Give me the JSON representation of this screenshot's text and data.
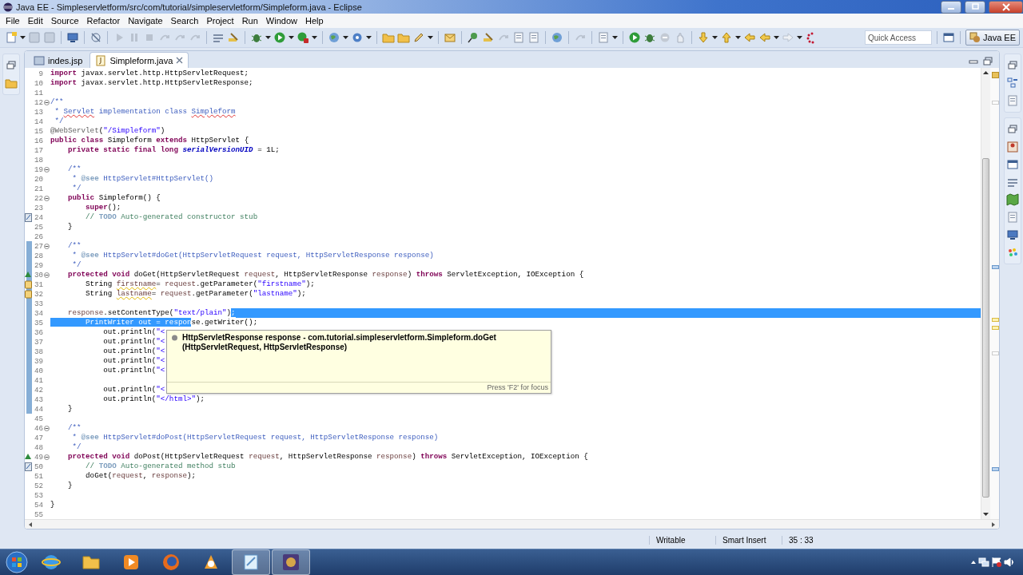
{
  "window": {
    "title": "Java EE - Simpleservletform/src/com/tutorial/simpleservletform/Simpleform.java - Eclipse"
  },
  "menu": [
    "File",
    "Edit",
    "Source",
    "Refactor",
    "Navigate",
    "Search",
    "Project",
    "Run",
    "Window",
    "Help"
  ],
  "toolbar": {
    "quick_access": {
      "placeholder": "Quick Access"
    },
    "perspective": {
      "label": "Java EE",
      "selected": true
    }
  },
  "editor": {
    "tabs": [
      {
        "label": "indes.jsp",
        "kind": "jsp",
        "selected": false,
        "closable": false
      },
      {
        "label": "Simpleform.java",
        "kind": "java",
        "selected": true,
        "closable": true
      }
    ],
    "lines": [
      {
        "number": "9",
        "kind": "code",
        "folding": false,
        "changed": false,
        "selected_to_end": false,
        "segments": [
          {
            "kind": "kw",
            "text": "import"
          },
          {
            "kind": "text",
            "text": " javax.servlet.http.HttpServletRequest;"
          }
        ]
      },
      {
        "number": "10",
        "kind": "code",
        "folding": false,
        "changed": false,
        "selected_to_end": false,
        "segments": [
          {
            "kind": "kw",
            "text": "import"
          },
          {
            "kind": "text",
            "text": " javax.servlet.http.HttpServletResponse;"
          }
        ]
      },
      {
        "number": "11",
        "kind": "code",
        "folding": false,
        "changed": false,
        "selected_to_end": false
      },
      {
        "number": "12",
        "kind": "code",
        "folding": true,
        "changed": false,
        "selected_to_end": false,
        "segments": [
          {
            "kind": "doc",
            "text": "/**"
          }
        ]
      },
      {
        "number": "13",
        "kind": "code",
        "folding": false,
        "changed": false,
        "selected_to_end": false,
        "segments": [
          {
            "kind": "doc",
            "text": " * "
          },
          {
            "kind": "misspelled",
            "text": "Servlet"
          },
          {
            "kind": "doc",
            "text": " implementation class "
          },
          {
            "kind": "misspelled",
            "text": "Simpleform"
          }
        ]
      },
      {
        "number": "14",
        "kind": "code",
        "folding": false,
        "changed": false,
        "selected_to_end": false,
        "segments": [
          {
            "kind": "doc",
            "text": " */"
          }
        ]
      },
      {
        "number": "15",
        "kind": "code",
        "folding": false,
        "changed": false,
        "selected_to_end": false,
        "segments": [
          {
            "kind": "annot",
            "text": "@WebServlet"
          },
          {
            "kind": "text",
            "text": "("
          },
          {
            "kind": "string",
            "text": "\"/Simpleform\""
          },
          {
            "kind": "text",
            "text": ")"
          }
        ]
      },
      {
        "number": "16",
        "kind": "code",
        "folding": false,
        "changed": false,
        "selected_to_end": false,
        "segments": [
          {
            "kind": "kw",
            "text": "public class"
          },
          {
            "kind": "text",
            "text": " Simpleform "
          },
          {
            "kind": "kw",
            "text": "extends"
          },
          {
            "kind": "text",
            "text": " HttpServlet {"
          }
        ]
      },
      {
        "number": "17",
        "kind": "code",
        "folding": false,
        "changed": false,
        "selected_to_end": false,
        "segments": [
          {
            "kind": "kw",
            "text": "    private static final long "
          },
          {
            "kind": "field",
            "text": "serialVersionUID"
          },
          {
            "kind": "text",
            "text": " = 1L;"
          }
        ]
      },
      {
        "number": "18",
        "kind": "code",
        "folding": false,
        "changed": false,
        "selected_to_end": false
      },
      {
        "number": "19",
        "kind": "code",
        "folding": true,
        "changed": false,
        "selected_to_end": false,
        "segments": [
          {
            "kind": "doc",
            "text": "    /**"
          }
        ]
      },
      {
        "number": "20",
        "kind": "code",
        "folding": false,
        "changed": false,
        "selected_to_end": false,
        "segments": [
          {
            "kind": "doc",
            "text": "     * "
          },
          {
            "kind": "doctag",
            "text": "@see"
          },
          {
            "kind": "doc",
            "text": " HttpServlet#HttpServlet()"
          }
        ]
      },
      {
        "number": "21",
        "kind": "code",
        "folding": false,
        "changed": false,
        "selected_to_end": false,
        "segments": [
          {
            "kind": "doc",
            "text": "     */"
          }
        ]
      },
      {
        "number": "22",
        "kind": "code",
        "folding": true,
        "changed": false,
        "selected_to_end": false,
        "segments": [
          {
            "kind": "kw",
            "text": "    public"
          },
          {
            "kind": "text",
            "text": " Simpleform() {"
          }
        ]
      },
      {
        "number": "23",
        "kind": "code",
        "folding": false,
        "changed": false,
        "selected_to_end": false,
        "segments": [
          {
            "kind": "kw",
            "text": "        super"
          },
          {
            "kind": "text",
            "text": "();"
          }
        ]
      },
      {
        "number": "24",
        "kind": "task",
        "folding": false,
        "changed": false,
        "selected_to_end": false,
        "segments": [
          {
            "kind": "comment",
            "text": "        // "
          },
          {
            "kind": "todo",
            "text": "TODO"
          },
          {
            "kind": "comment",
            "text": " Auto-generated constructor stub"
          }
        ]
      },
      {
        "number": "25",
        "kind": "code",
        "folding": false,
        "changed": false,
        "selected_to_end": false,
        "segments": [
          {
            "kind": "text",
            "text": "    }"
          }
        ]
      },
      {
        "number": "26",
        "kind": "code",
        "folding": false,
        "changed": false,
        "selected_to_end": false
      },
      {
        "number": "27",
        "kind": "code",
        "folding": true,
        "changed": true,
        "selected_to_end": false,
        "segments": [
          {
            "kind": "doc",
            "text": "    /**"
          }
        ]
      },
      {
        "number": "28",
        "kind": "code",
        "folding": false,
        "changed": true,
        "selected_to_end": false,
        "segments": [
          {
            "kind": "doc",
            "text": "     * "
          },
          {
            "kind": "doctag",
            "text": "@see"
          },
          {
            "kind": "doc",
            "text": " HttpServlet#doGet(HttpServletRequest request, HttpServletResponse response)"
          }
        ]
      },
      {
        "number": "29",
        "kind": "code",
        "folding": false,
        "changed": true,
        "selected_to_end": false,
        "segments": [
          {
            "kind": "doc",
            "text": "     */"
          }
        ]
      },
      {
        "number": "30",
        "kind": "override",
        "folding": true,
        "changed": true,
        "selected_to_end": false,
        "segments": [
          {
            "kind": "kw",
            "text": "    protected void"
          },
          {
            "kind": "text",
            "text": " doGet(HttpServletRequest "
          },
          {
            "kind": "param",
            "text": "request"
          },
          {
            "kind": "text",
            "text": ", HttpServletResponse "
          },
          {
            "kind": "param",
            "text": "response"
          },
          {
            "kind": "text",
            "text": ") "
          },
          {
            "kind": "kw",
            "text": "throws"
          },
          {
            "kind": "text",
            "text": " ServletException, IOException {"
          }
        ]
      },
      {
        "number": "31",
        "kind": "warning",
        "folding": false,
        "changed": true,
        "selected_to_end": false,
        "segments": [
          {
            "kind": "text",
            "text": "        String "
          },
          {
            "kind": "warned",
            "text": "firstname"
          },
          {
            "kind": "text",
            "text": "= "
          },
          {
            "kind": "param",
            "text": "request"
          },
          {
            "kind": "text",
            "text": ".getParameter("
          },
          {
            "kind": "string",
            "text": "\"firstname\""
          },
          {
            "kind": "text",
            "text": ");"
          }
        ]
      },
      {
        "number": "32",
        "kind": "warning",
        "folding": false,
        "changed": true,
        "selected_to_end": false,
        "segments": [
          {
            "kind": "text",
            "text": "        String "
          },
          {
            "kind": "warned",
            "text": "lastname"
          },
          {
            "kind": "text",
            "text": "= "
          },
          {
            "kind": "param",
            "text": "request"
          },
          {
            "kind": "text",
            "text": ".getParameter("
          },
          {
            "kind": "string",
            "text": "\"lastname\""
          },
          {
            "kind": "text",
            "text": ");"
          }
        ]
      },
      {
        "number": "33",
        "kind": "code",
        "folding": false,
        "changed": true,
        "selected_to_end": false
      },
      {
        "number": "34",
        "kind": "code",
        "folding": false,
        "changed": true,
        "selected_to_end": true,
        "segments": [
          {
            "kind": "param",
            "text": "    response"
          },
          {
            "kind": "text",
            "text": ".setContentType("
          },
          {
            "kind": "string",
            "text": "\"text/plain\""
          },
          {
            "kind": "text",
            "text": ")"
          },
          {
            "kind": "selected",
            "text": ";"
          }
        ]
      },
      {
        "number": "35",
        "kind": "code",
        "folding": false,
        "changed": true,
        "selected_to_end": false,
        "segments": [
          {
            "kind": "selected",
            "text": "        PrintWriter out = respon"
          },
          {
            "kind": "text",
            "text": "se.getWriter();"
          }
        ]
      },
      {
        "number": "36",
        "kind": "code",
        "folding": false,
        "changed": true,
        "selected_to_end": false,
        "segments": [
          {
            "kind": "text",
            "text": "            out.println("
          },
          {
            "kind": "string",
            "text": "\"<"
          }
        ]
      },
      {
        "number": "37",
        "kind": "code",
        "folding": false,
        "changed": true,
        "selected_to_end": false,
        "segments": [
          {
            "kind": "text",
            "text": "            out.println("
          },
          {
            "kind": "string",
            "text": "\"<"
          }
        ]
      },
      {
        "number": "38",
        "kind": "code",
        "folding": false,
        "changed": true,
        "selected_to_end": false,
        "segments": [
          {
            "kind": "text",
            "text": "            out.println("
          },
          {
            "kind": "string",
            "text": "\"<"
          }
        ]
      },
      {
        "number": "39",
        "kind": "code",
        "folding": false,
        "changed": true,
        "selected_to_end": false,
        "segments": [
          {
            "kind": "text",
            "text": "            out.println("
          },
          {
            "kind": "string",
            "text": "\"<"
          }
        ]
      },
      {
        "number": "40",
        "kind": "code",
        "folding": false,
        "changed": true,
        "selected_to_end": false,
        "segments": [
          {
            "kind": "text",
            "text": "            out.println("
          },
          {
            "kind": "string",
            "text": "\"<"
          }
        ]
      },
      {
        "number": "41",
        "kind": "code",
        "folding": false,
        "changed": true,
        "selected_to_end": false
      },
      {
        "number": "42",
        "kind": "code",
        "folding": false,
        "changed": true,
        "selected_to_end": false,
        "segments": [
          {
            "kind": "text",
            "text": "            out.println("
          },
          {
            "kind": "string",
            "text": "\"<"
          }
        ]
      },
      {
        "number": "43",
        "kind": "code",
        "folding": false,
        "changed": true,
        "selected_to_end": false,
        "segments": [
          {
            "kind": "text",
            "text": "            out.println("
          },
          {
            "kind": "string",
            "text": "\"</html>\""
          },
          {
            "kind": "text",
            "text": ");"
          }
        ]
      },
      {
        "number": "44",
        "kind": "code",
        "folding": false,
        "changed": true,
        "selected_to_end": false,
        "segments": [
          {
            "kind": "text",
            "text": "    }"
          }
        ]
      },
      {
        "number": "45",
        "kind": "code",
        "folding": false,
        "changed": false,
        "selected_to_end": false
      },
      {
        "number": "46",
        "kind": "code",
        "folding": true,
        "changed": false,
        "selected_to_end": false,
        "segments": [
          {
            "kind": "doc",
            "text": "    /**"
          }
        ]
      },
      {
        "number": "47",
        "kind": "code",
        "folding": false,
        "changed": false,
        "selected_to_end": false,
        "segments": [
          {
            "kind": "doc",
            "text": "     * "
          },
          {
            "kind": "doctag",
            "text": "@see"
          },
          {
            "kind": "doc",
            "text": " HttpServlet#doPost(HttpServletRequest request, HttpServletResponse response)"
          }
        ]
      },
      {
        "number": "48",
        "kind": "code",
        "folding": false,
        "changed": false,
        "selected_to_end": false,
        "segments": [
          {
            "kind": "doc",
            "text": "     */"
          }
        ]
      },
      {
        "number": "49",
        "kind": "override",
        "folding": true,
        "changed": false,
        "selected_to_end": false,
        "segments": [
          {
            "kind": "kw",
            "text": "    protected void"
          },
          {
            "kind": "text",
            "text": " doPost(HttpServletRequest "
          },
          {
            "kind": "param",
            "text": "request"
          },
          {
            "kind": "text",
            "text": ", HttpServletResponse "
          },
          {
            "kind": "param",
            "text": "response"
          },
          {
            "kind": "text",
            "text": ") "
          },
          {
            "kind": "kw",
            "text": "throws"
          },
          {
            "kind": "text",
            "text": " ServletException, IOException {"
          }
        ]
      },
      {
        "number": "50",
        "kind": "task",
        "folding": false,
        "changed": false,
        "selected_to_end": false,
        "segments": [
          {
            "kind": "comment",
            "text": "        // "
          },
          {
            "kind": "todo",
            "text": "TODO"
          },
          {
            "kind": "comment",
            "text": " Auto-generated method stub"
          }
        ]
      },
      {
        "number": "51",
        "kind": "code",
        "folding": false,
        "changed": false,
        "selected_to_end": false,
        "segments": [
          {
            "kind": "text",
            "text": "        doGet("
          },
          {
            "kind": "param",
            "text": "request"
          },
          {
            "kind": "text",
            "text": ", "
          },
          {
            "kind": "param",
            "text": "response"
          },
          {
            "kind": "text",
            "text": ");"
          }
        ]
      },
      {
        "number": "52",
        "kind": "code",
        "folding": false,
        "changed": false,
        "selected_to_end": false,
        "segments": [
          {
            "kind": "text",
            "text": "    }"
          }
        ]
      },
      {
        "number": "53",
        "kind": "code",
        "folding": false,
        "changed": false,
        "selected_to_end": false
      },
      {
        "number": "54",
        "kind": "code",
        "folding": false,
        "changed": false,
        "selected_to_end": false,
        "segments": [
          {
            "kind": "text",
            "text": "}"
          }
        ]
      },
      {
        "number": "55",
        "kind": "code",
        "folding": false,
        "changed": false,
        "selected_to_end": false
      }
    ],
    "hover": {
      "lines": [
        "HttpServletResponse response - com.tutorial.simpleservletform.Simpleform.doGet",
        "(HttpServletRequest, HttpServletResponse)"
      ],
      "footer": "Press 'F2' for focus"
    }
  },
  "status_bar": {
    "items": [
      "Writable",
      "Smart Insert",
      "35 : 33"
    ]
  }
}
